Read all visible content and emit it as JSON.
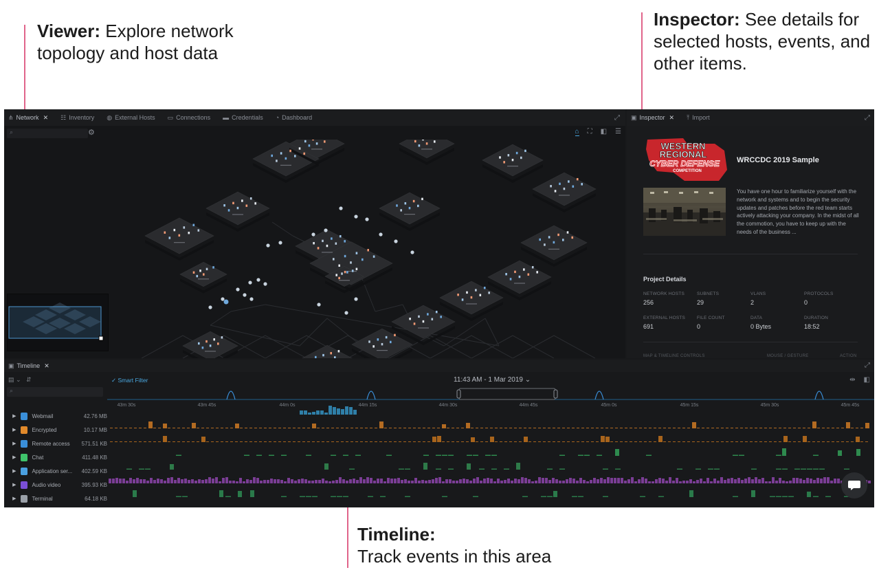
{
  "callouts": {
    "viewer": {
      "title": "Viewer:",
      "text": " Explore network topology and host data"
    },
    "inspector": {
      "title": "Inspector:",
      "text": " See details for selected hosts, events, and other items."
    },
    "timeline": {
      "title": "Timeline:",
      "text": "Track events in this area"
    }
  },
  "viewer": {
    "tabs": [
      {
        "label": "Network",
        "icon": "network-icon",
        "active": true,
        "closable": true
      },
      {
        "label": "Inventory",
        "icon": "inventory-icon"
      },
      {
        "label": "External Hosts",
        "icon": "external-hosts-icon"
      },
      {
        "label": "Connections",
        "icon": "connections-icon"
      },
      {
        "label": "Credentials",
        "icon": "credentials-icon"
      },
      {
        "label": "Dashboard",
        "icon": "dashboard-icon"
      }
    ],
    "close_glyph": "✕"
  },
  "inspector": {
    "tabs": [
      {
        "label": "Inspector",
        "icon": "inspector-icon",
        "active": true,
        "closable": true
      },
      {
        "label": "Import",
        "icon": "import-icon"
      }
    ],
    "logo": {
      "line1": "WESTERN",
      "line2": "REGIONAL",
      "line3": "CYBER DEFENSE",
      "line4": "COMPETITION"
    },
    "project_title": "WRCCDC 2019 Sample",
    "description": "You have one hour to familiarize yourself with the network and systems and to begin the security updates and patches before the red team starts actively attacking your company. In the midst of all the commotion, you have to keep up with the needs of the business ...",
    "details_title": "Project Details",
    "stats": [
      {
        "label": "NETWORK HOSTS",
        "value": "256"
      },
      {
        "label": "SUBNETS",
        "value": "29"
      },
      {
        "label": "VLANS",
        "value": "2"
      },
      {
        "label": "PROTOCOLS",
        "value": "0"
      },
      {
        "label": "EXTERNAL HOSTS",
        "value": "691"
      },
      {
        "label": "FILE COUNT",
        "value": "0"
      },
      {
        "label": "DATA",
        "value": "0 Bytes"
      },
      {
        "label": "DURATION",
        "value": "18:52"
      }
    ],
    "footer": {
      "left": "MAP & TIMELINE CONTROLS",
      "mid": "MOUSE / GESTURE",
      "right": "ACTION"
    }
  },
  "timeline": {
    "tab_label": "Timeline",
    "smart_filter": "✓ Smart Filter",
    "date_label": "11:43 AM - 1 Mar 2019",
    "ticks": [
      "43m 30s",
      "43m 45s",
      "44m 0s",
      "44m 15s",
      "44m 30s",
      "44m 45s",
      "45m 0s",
      "45m 15s",
      "45m 30s",
      "45m 45s"
    ],
    "categories": [
      {
        "name": "Webmail",
        "size": "42.76 MB",
        "color": "#3a8fd9",
        "icon": "webmail-icon"
      },
      {
        "name": "Encrypted",
        "size": "10.17 MB",
        "color": "#e28a2b",
        "icon": "lock-icon"
      },
      {
        "name": "Remote access",
        "size": "571.51 KB",
        "color": "#3a8fd9",
        "icon": "remote-access-icon"
      },
      {
        "name": "Chat",
        "size": "411.48 KB",
        "color": "#3fc36b",
        "icon": "chat-icon"
      },
      {
        "name": "Application ser...",
        "size": "402.59 KB",
        "color": "#4aa0e0",
        "icon": "application-server-icon"
      },
      {
        "name": "Audio video",
        "size": "395.93 KB",
        "color": "#7a4fd6",
        "icon": "audio-video-icon"
      },
      {
        "name": "Terminal",
        "size": "64.18 KB",
        "color": "#9aa0a8",
        "icon": "terminal-icon"
      }
    ],
    "bar_colors": {
      "Webmail": "#2f7fa8",
      "Encrypted": "#b36b22",
      "Remote access": "#a8641c",
      "Chat": "#2e8a4e",
      "Application ser...": "#2e7a49",
      "Audio video": "#7a3d95",
      "Terminal": "#2a7a4a"
    }
  }
}
